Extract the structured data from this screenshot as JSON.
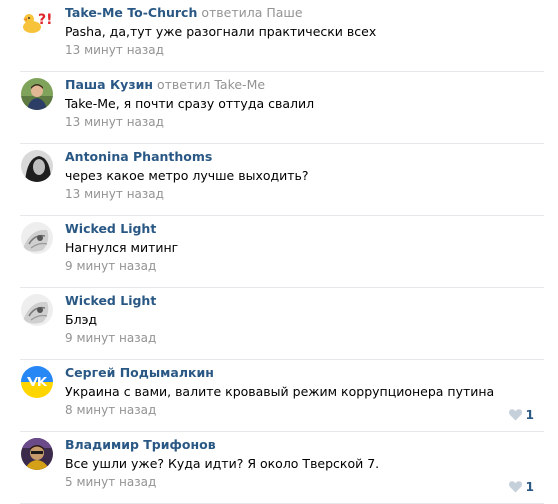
{
  "comments": [
    {
      "author": "Take-Me To-Church",
      "reply_verb": "ответила",
      "reply_target": "Паше",
      "text": "Pasha, да,тут уже разогнали практически всех",
      "time": "13 минут назад",
      "avatar": "duck-emoji-avatar"
    },
    {
      "author": "Паша Кузин",
      "reply_verb": "ответил",
      "reply_target": "Take-Me",
      "text": "Take-Me, я почти сразу оттуда свалил",
      "time": "13 минут назад",
      "avatar": "photo-avatar"
    },
    {
      "author": "Antonina Phanthoms",
      "text": "через какое метро лучше выходить?",
      "time": "13 минут назад",
      "avatar": "photo-avatar"
    },
    {
      "author": "Wicked Light",
      "text": "Нагнулся митинг",
      "time": "9 минут назад",
      "avatar": "photo-avatar"
    },
    {
      "author": "Wicked Light",
      "text": "Блэд",
      "time": "9 минут назад",
      "avatar": "photo-avatar"
    },
    {
      "author": "Сергей Подымалкин",
      "text": "Украина с вами, валите кровавый режим коррупционера путина",
      "time": "8 минут назад",
      "likes": "1",
      "avatar": "vk-logo-avatar"
    },
    {
      "author": "Владимир Трифонов",
      "text": "Все ушли уже? Куда идти? Я около Тверской 7.",
      "time": "5 минут назад",
      "likes": "1",
      "avatar": "photo-avatar"
    }
  ],
  "colors": {
    "author_link": "#2a5885",
    "meta_gray": "#939393",
    "divider": "#e7e8ec",
    "like_heart": "#c5d0db"
  }
}
